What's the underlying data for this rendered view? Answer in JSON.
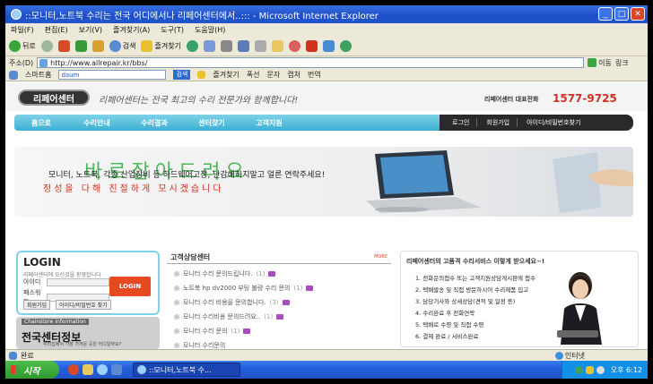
{
  "window": {
    "title": "::모니터,노트북 수리는 전국 어디에서나 리페어센터에서..::: - Microsoft Internet Explorer"
  },
  "menubar": {
    "items": [
      "파일(F)",
      "편집(E)",
      "보기(V)",
      "즐겨찾기(A)",
      "도구(T)",
      "도움말(H)"
    ]
  },
  "toolbar": {
    "back_label": "뒤로",
    "search_label": "검색",
    "favorites_label": "즐겨찾기"
  },
  "address": {
    "label": "주소(D)",
    "url": "http://www.allrepair.kr/bbs/",
    "go_label": "이동",
    "links_label": "링크"
  },
  "linksbar": {
    "smartbar_label": "스마트홈",
    "search_button": "검색",
    "favorites": "즐겨찾기",
    "items": [
      "폭선",
      "문자",
      "캡처",
      "번역"
    ]
  },
  "site": {
    "tagline": "리페어센터는 전국 최고의 수리 전문가와 함께합니다!",
    "hotline_label": "리페어센터 대표전화",
    "hotline": "1577-9725",
    "nav": [
      "홈으로",
      "수리안내",
      "수리결과",
      "센터찾기",
      "고객지원"
    ],
    "user_links": [
      "로그인",
      "회원가입",
      "아이디/비밀번호찾기"
    ],
    "banner": {
      "line1": "모니터, 노트북, 각종 산업장비 등 하드웨어고장, 난감해하지말고 얼른 연락주세요!",
      "line2": "정성을 다해 친절하게 모시겠습니다",
      "overlay": "바로잡아드려요"
    },
    "login": {
      "title": "LOGIN",
      "subtitle": "리페어센터에 오신것을 환영합니다",
      "id_label": "아이디",
      "pw_label": "패스워드",
      "button": "LOGIN",
      "join": "회원가입",
      "find": "아이디/비밀번호 찾기"
    },
    "chainstore": {
      "label": "Chainstore information",
      "title": "전국센터정보",
      "subtitle": "우리집에서 가장 가까운 곳은 어디일까요?"
    },
    "consult": {
      "title": "고객상담센터",
      "more": "MORE",
      "items": [
        {
          "text": "모니터 수리 문의드립니다.",
          "count": "(1)"
        },
        {
          "text": "노트북 hp dv2000 부팅 불량 수리 문의",
          "count": "(1)"
        },
        {
          "text": "모니터 수리 비용을 문의합니다.",
          "count": "(3)"
        },
        {
          "text": "모니터 수리비용 문의드려요..",
          "count": "(1)"
        },
        {
          "text": "모니터 수리 문의",
          "count": "(1)"
        },
        {
          "text": "모니터 수리문의",
          "count": ""
        }
      ]
    },
    "service": {
      "title": "리페어센터의 고품격 수리서비스 이렇게 받으세요~!",
      "steps": [
        "1. 전화문의접수 또는 고객지원상담게시판에 접수",
        "2. 택배발송 및 직접 방문하시어 수리제품 입고",
        "3. 담당기사와 상세상담(견적 및 일정 등)",
        "4. 수리완료 후 전화연락",
        "5. 택배로 수령 및 직접 수령",
        "6. 결제 완료 / 서비스완료"
      ]
    }
  },
  "statusbar": {
    "text": "완료",
    "zone": "인터넷"
  },
  "taskbar": {
    "start": "시작",
    "task_label": "::모니터,노트북 수...",
    "clock": "오후 6:12"
  },
  "colors": {
    "ie_blue": "#245edb",
    "nav_cyan": "#3ab0d3",
    "hotline_red": "#d03020",
    "login_orange": "#e54a20",
    "start_green": "#2f9a2f"
  }
}
